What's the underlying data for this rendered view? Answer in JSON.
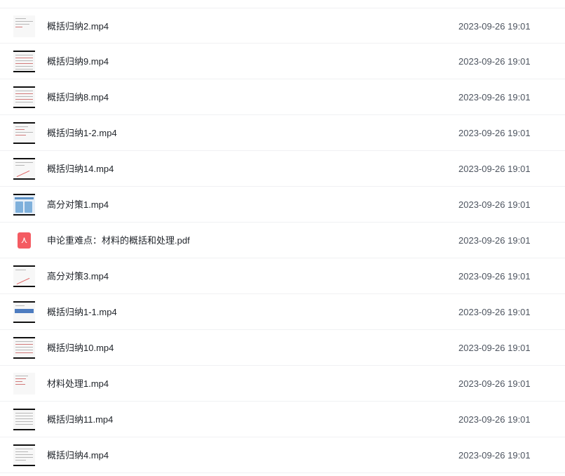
{
  "files": [
    {
      "name": "概括归纳2.mp4",
      "time": "2023-09-26 19:01",
      "type": "video",
      "icon": "video-thumbnail-icon"
    },
    {
      "name": "概括归纳9.mp4",
      "time": "2023-09-26 19:01",
      "type": "video",
      "icon": "video-thumbnail-icon"
    },
    {
      "name": "概括归纳8.mp4",
      "time": "2023-09-26 19:01",
      "type": "video",
      "icon": "video-thumbnail-icon"
    },
    {
      "name": "概括归纳1-2.mp4",
      "time": "2023-09-26 19:01",
      "type": "video",
      "icon": "video-thumbnail-icon"
    },
    {
      "name": "概括归纳14.mp4",
      "time": "2023-09-26 19:01",
      "type": "video",
      "icon": "video-thumbnail-icon"
    },
    {
      "name": "高分对策1.mp4",
      "time": "2023-09-26 19:01",
      "type": "video",
      "icon": "video-thumbnail-icon"
    },
    {
      "name": "申论重难点：材料的概括和处理.pdf",
      "time": "2023-09-26 19:01",
      "type": "pdf",
      "icon": "pdf-icon"
    },
    {
      "name": "高分对策3.mp4",
      "time": "2023-09-26 19:01",
      "type": "video",
      "icon": "video-thumbnail-icon"
    },
    {
      "name": "概括归纳1-1.mp4",
      "time": "2023-09-26 19:01",
      "type": "video",
      "icon": "video-thumbnail-icon"
    },
    {
      "name": "概括归纳10.mp4",
      "time": "2023-09-26 19:01",
      "type": "video",
      "icon": "video-thumbnail-icon"
    },
    {
      "name": "材料处理1.mp4",
      "time": "2023-09-26 19:01",
      "type": "video",
      "icon": "video-thumbnail-icon"
    },
    {
      "name": "概括归纳11.mp4",
      "time": "2023-09-26 19:01",
      "type": "video",
      "icon": "video-thumbnail-icon"
    },
    {
      "name": "概括归纳4.mp4",
      "time": "2023-09-26 19:01",
      "type": "video",
      "icon": "video-thumbnail-icon"
    }
  ],
  "colors": {
    "text": "#1f2329",
    "time_text": "#4e5560",
    "divider": "#f0f1f3",
    "pdf_red": "#f45b62"
  }
}
